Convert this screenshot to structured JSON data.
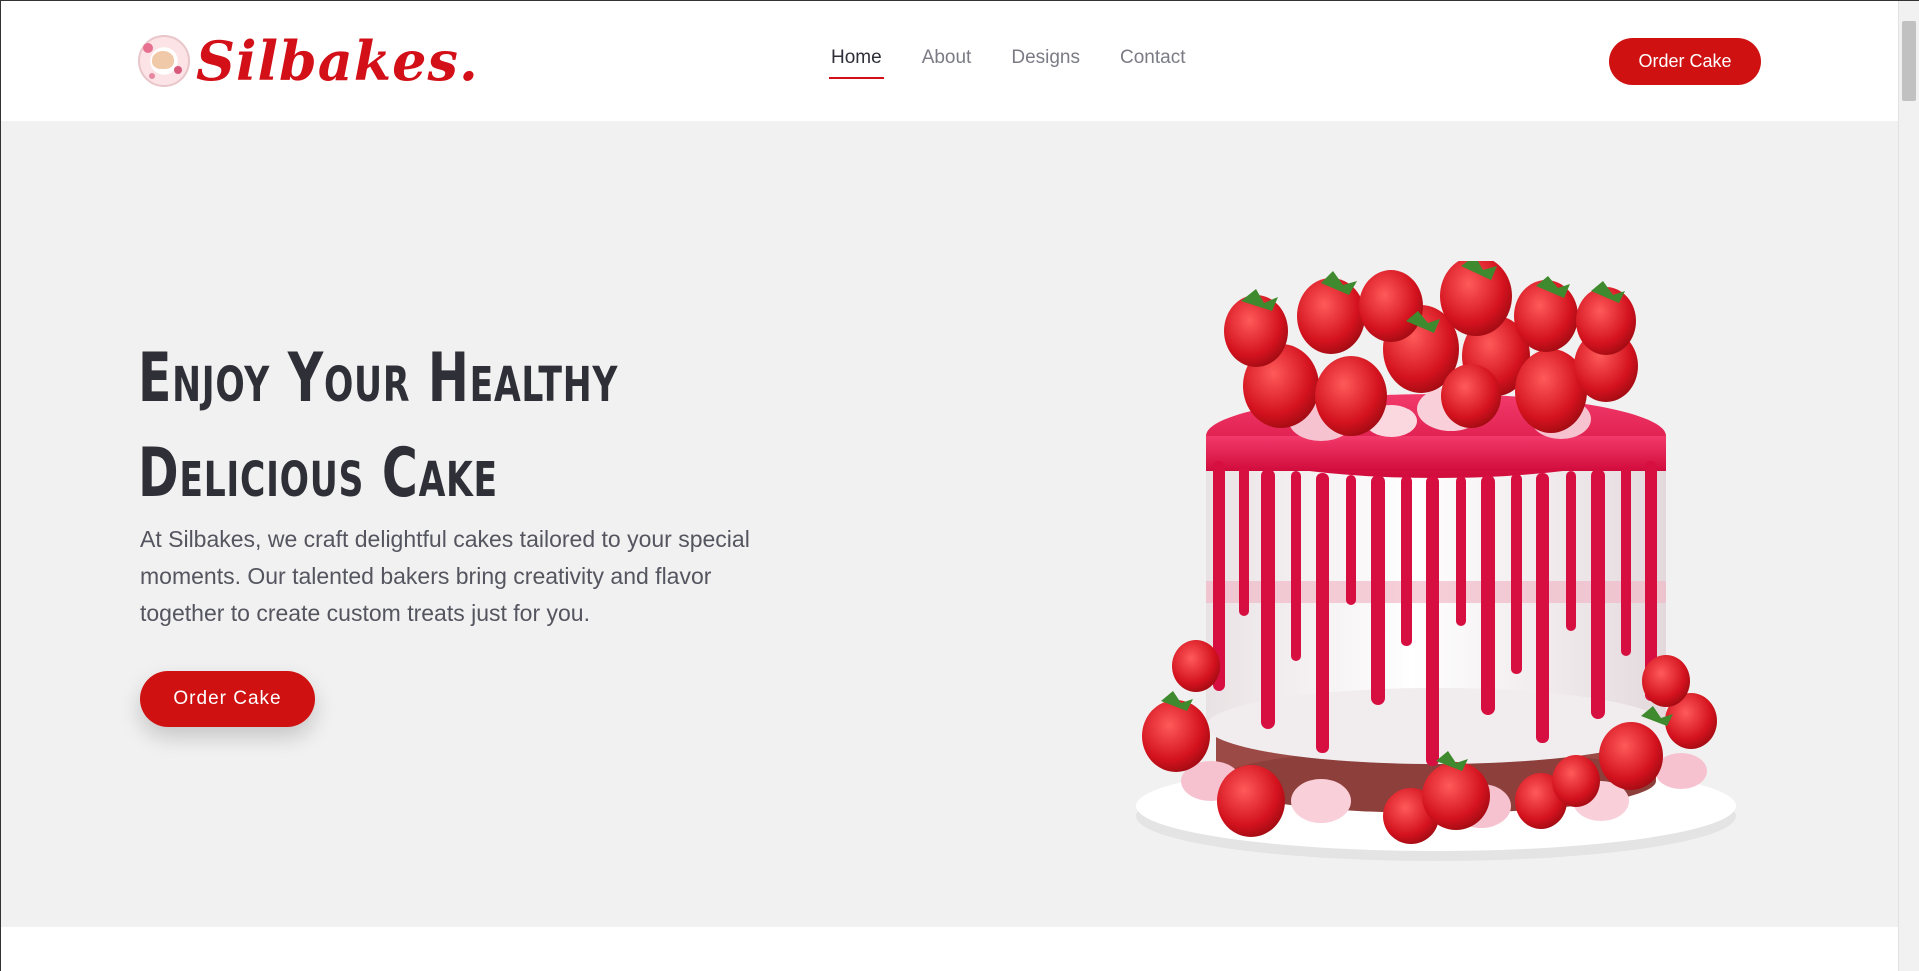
{
  "header": {
    "brand_name": "Silbakes.",
    "logo_icon": "silbakes-logo",
    "nav": [
      {
        "label": "Home",
        "active": true
      },
      {
        "label": "About",
        "active": false
      },
      {
        "label": "Designs",
        "active": false
      },
      {
        "label": "Contact",
        "active": false
      }
    ],
    "cta_label": "Order Cake"
  },
  "hero": {
    "title_line1": "Enjoy Your Healthy",
    "title_line2": "Delicious Cake",
    "description": "At Silbakes, we craft delightful cakes tailored to your special moments. Our talented bakers bring creativity and flavor together to create custom treats just for you.",
    "cta_label": "Order Cake",
    "image": "strawberry-drip-cake"
  },
  "colors": {
    "accent": "#cf1111",
    "hero_background": "#f1f1f1",
    "heading": "#2f2f37",
    "body_text": "#555560"
  }
}
